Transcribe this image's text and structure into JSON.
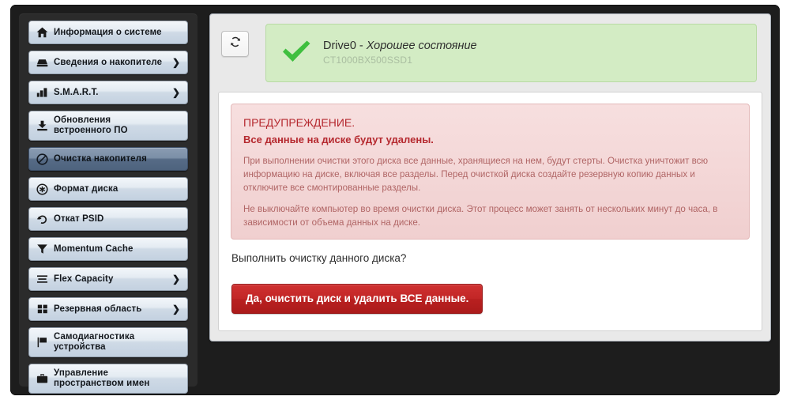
{
  "sidebar": {
    "items": [
      {
        "label": "Информация о системе",
        "icon": "home-icon",
        "chevron": false,
        "selected": false
      },
      {
        "label": "Сведения о накопителе",
        "icon": "hard-drive-icon",
        "chevron": true,
        "selected": false
      },
      {
        "label": "S.M.A.R.T.",
        "icon": "bar-chart-icon",
        "chevron": true,
        "selected": false
      },
      {
        "label": "Обновления\nвстроенного ПО",
        "icon": "download-icon",
        "chevron": false,
        "selected": false
      },
      {
        "label": "Очистка накопителя",
        "icon": "ban-icon",
        "chevron": false,
        "selected": true
      },
      {
        "label": "Формат диска",
        "icon": "asterisk-circle-icon",
        "chevron": false,
        "selected": false
      },
      {
        "label": "Откат PSID",
        "icon": "revert-icon",
        "chevron": false,
        "selected": false
      },
      {
        "label": "Momentum Cache",
        "icon": "funnel-icon",
        "chevron": false,
        "selected": false
      },
      {
        "label": "Flex Capacity",
        "icon": "list-lines-icon",
        "chevron": true,
        "selected": false
      },
      {
        "label": "Резервная область",
        "icon": "grid-squares-icon",
        "chevron": true,
        "selected": false
      },
      {
        "label": "Самодиагностика\nустройства",
        "icon": "flag-icon",
        "chevron": false,
        "selected": false
      },
      {
        "label": "Управление\nпространством имен",
        "icon": "briefcase-icon",
        "chevron": false,
        "selected": false
      }
    ],
    "chevron_glyph": "❯"
  },
  "header": {
    "refresh_icon": "refresh-icon",
    "status_icon": "green-check-icon",
    "drive_name": "Drive0 - ",
    "drive_health": "Хорошее состояние",
    "drive_model": "CT1000BX500SSD1"
  },
  "warning": {
    "heading": "ПРЕДУПРЕЖДЕНИЕ.",
    "subheading": "Все данные на диске будут удалены.",
    "paragraph1": "При выполнении очистки этого диска все данные, хранящиеся на нем, будут стерты. Очистка уничтожит всю информацию на диске, включая все разделы. Перед очисткой диска создайте резервную копию данных и отключите все смонтированные разделы.",
    "paragraph2": "Не выключайте компьютер во время очистки диска. Этот процесс может занять от нескольких минут до часа, в зависимости от объема данных на диске."
  },
  "action": {
    "prompt": "Выполнить очистку данного диска?",
    "erase_button_label": "Да, очистить диск и удалить ВСЕ данные."
  },
  "colors": {
    "accent_red": "#b5282e",
    "button_red": "#c22626",
    "status_green_bg": "#d3ecc4",
    "status_green_border": "#b8dba4",
    "warning_bg": "#f3d5d5",
    "selected_nav": "#5d melt"
  }
}
